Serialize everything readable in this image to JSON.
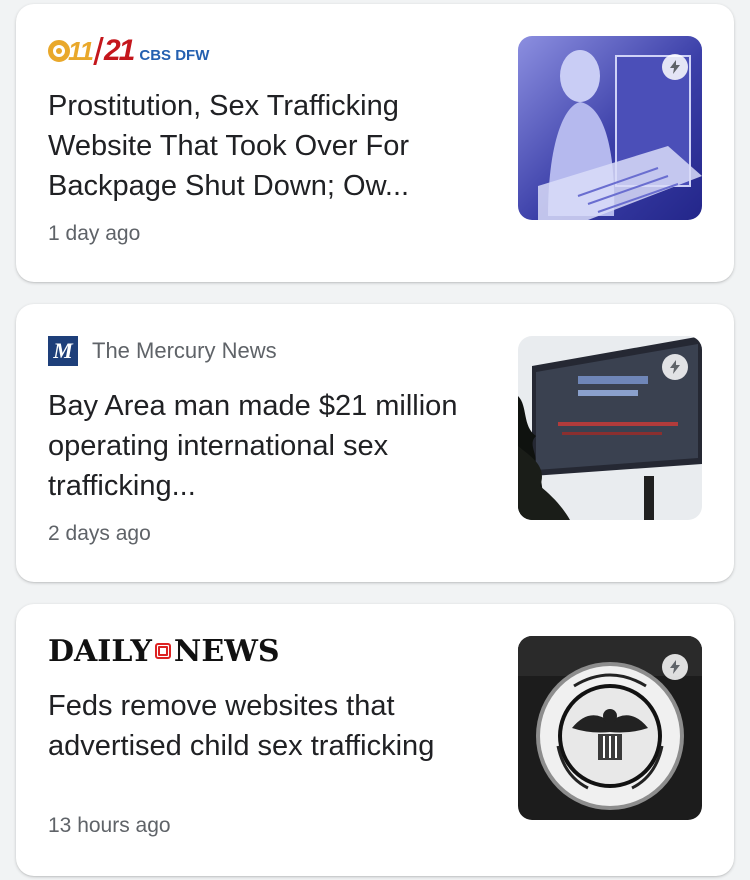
{
  "articles": [
    {
      "source": "CBS DFW",
      "logo_text": {
        "eleven": "11",
        "twentyone": "21",
        "brand": "CBS DFW"
      },
      "headline": "Prostitution, Sex Trafficking Website That Took Over For Backpage Shut Down; Ow...",
      "time": "1 day ago",
      "thumbnail": "illustration-icon",
      "badge": "amp-lightning-icon"
    },
    {
      "source": "The Mercury News",
      "logo_text": {
        "mark": "M"
      },
      "headline": "Bay Area man made $21 million operating international sex trafficking...",
      "time": "2 days ago",
      "thumbnail": "billboard-photo",
      "badge": "amp-lightning-icon"
    },
    {
      "source": "Daily News",
      "logo_text": {
        "left": "DAILY",
        "right": "NEWS"
      },
      "headline": "Feds remove websites that advertised child sex trafficking",
      "time": "13 hours ago",
      "thumbnail": "dhs-seal-photo",
      "badge": "amp-lightning-icon"
    }
  ],
  "colors": {
    "cbs_gold": "#e9a82b",
    "cbs_red": "#c4161c",
    "cbs_blue": "#2460b0",
    "mercury_blue": "#1e3f7a",
    "headline_text": "#202124",
    "meta_text": "#5f6368"
  }
}
